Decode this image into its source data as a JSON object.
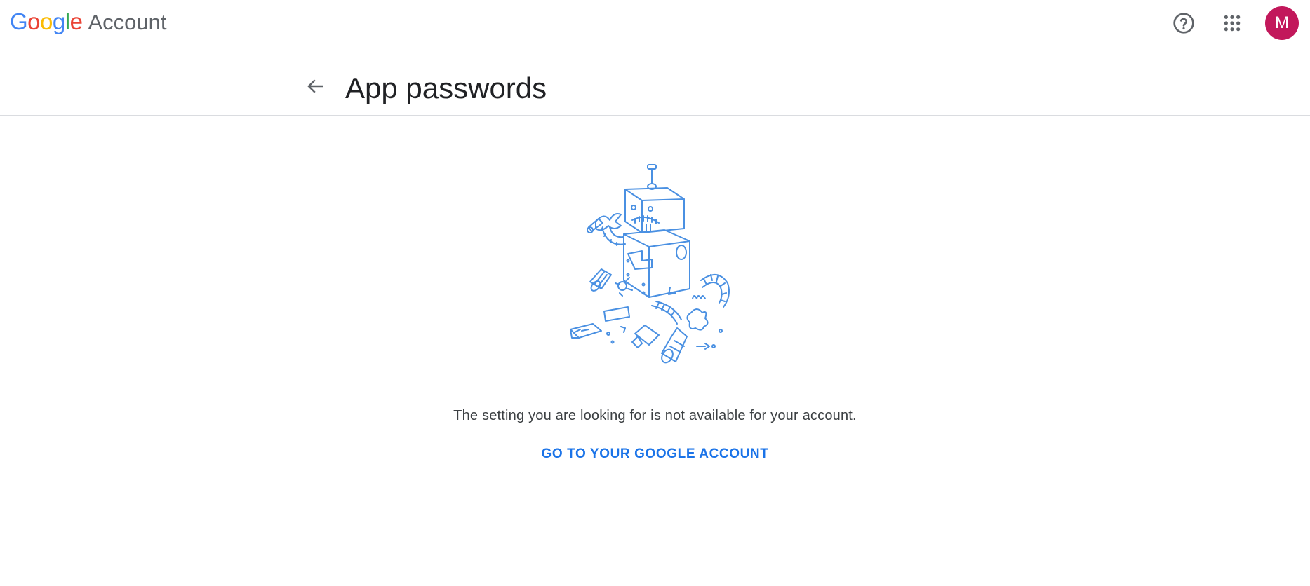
{
  "header": {
    "logo_brand": "Google",
    "logo_product": "Account",
    "avatar_initial": "M",
    "avatar_color": "#c2185b",
    "icons": [
      "help-icon",
      "apps-grid-icon"
    ]
  },
  "page": {
    "title": "App passwords",
    "back_icon": "arrow-back-icon"
  },
  "error": {
    "illustration": "broken-robot-illustration",
    "message": "The setting you are looking for is not available for your account.",
    "link_label": "GO TO YOUR GOOGLE ACCOUNT"
  },
  "colors": {
    "google_blue": "#4285F4",
    "google_red": "#EA4335",
    "google_yellow": "#FBBC05",
    "google_green": "#34A853",
    "link": "#1a73e8",
    "illustration_stroke": "#4a90e2"
  }
}
